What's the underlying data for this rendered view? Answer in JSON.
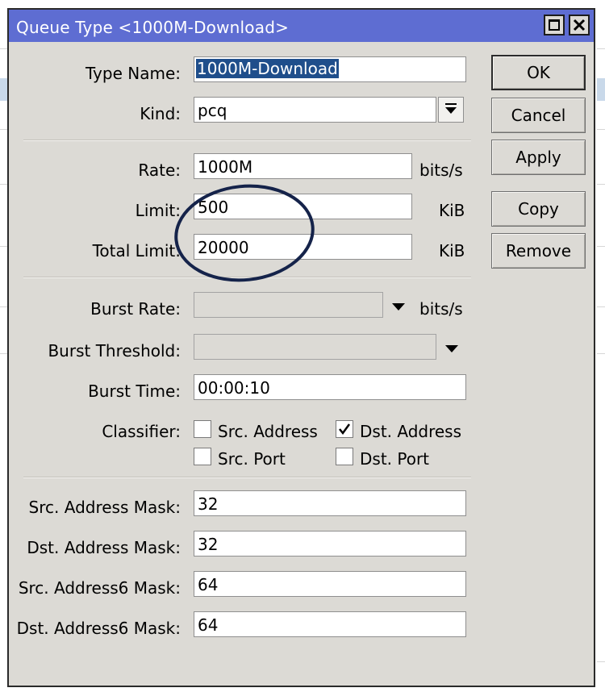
{
  "window": {
    "title": "Queue Type <1000M-Download>"
  },
  "form": {
    "type_name": {
      "label": "Type Name:",
      "value": "1000M-Download"
    },
    "kind": {
      "label": "Kind:",
      "value": "pcq"
    },
    "rate": {
      "label": "Rate:",
      "value": "1000M",
      "unit": "bits/s"
    },
    "limit": {
      "label": "Limit:",
      "value": "500",
      "unit": "KiB"
    },
    "total_limit": {
      "label": "Total Limit:",
      "value": "20000",
      "unit": "KiB"
    },
    "burst_rate": {
      "label": "Burst Rate:",
      "value": "",
      "unit": "bits/s"
    },
    "burst_threshold": {
      "label": "Burst Threshold:",
      "value": ""
    },
    "burst_time": {
      "label": "Burst Time:",
      "value": "00:00:10"
    },
    "classifier": {
      "label": "Classifier:",
      "options": [
        {
          "label": "Src. Address",
          "checked": false
        },
        {
          "label": "Dst. Address",
          "checked": true
        },
        {
          "label": "Src. Port",
          "checked": false
        },
        {
          "label": "Dst. Port",
          "checked": false
        }
      ]
    },
    "src_address_mask": {
      "label": "Src. Address Mask:",
      "value": "32"
    },
    "dst_address_mask": {
      "label": "Dst. Address Mask:",
      "value": "32"
    },
    "src_address6_mask": {
      "label": "Src. Address6 Mask:",
      "value": "64"
    },
    "dst_address6_mask": {
      "label": "Dst. Address6 Mask:",
      "value": "64"
    }
  },
  "buttons": {
    "ok": "OK",
    "cancel": "Cancel",
    "apply": "Apply",
    "copy": "Copy",
    "remove": "Remove"
  },
  "colors": {
    "title_bar": "#5e6dd2",
    "dialog_bg": "#dcdad5",
    "selection": "#1f4e8b",
    "annotation_ellipse": "#15234a"
  }
}
